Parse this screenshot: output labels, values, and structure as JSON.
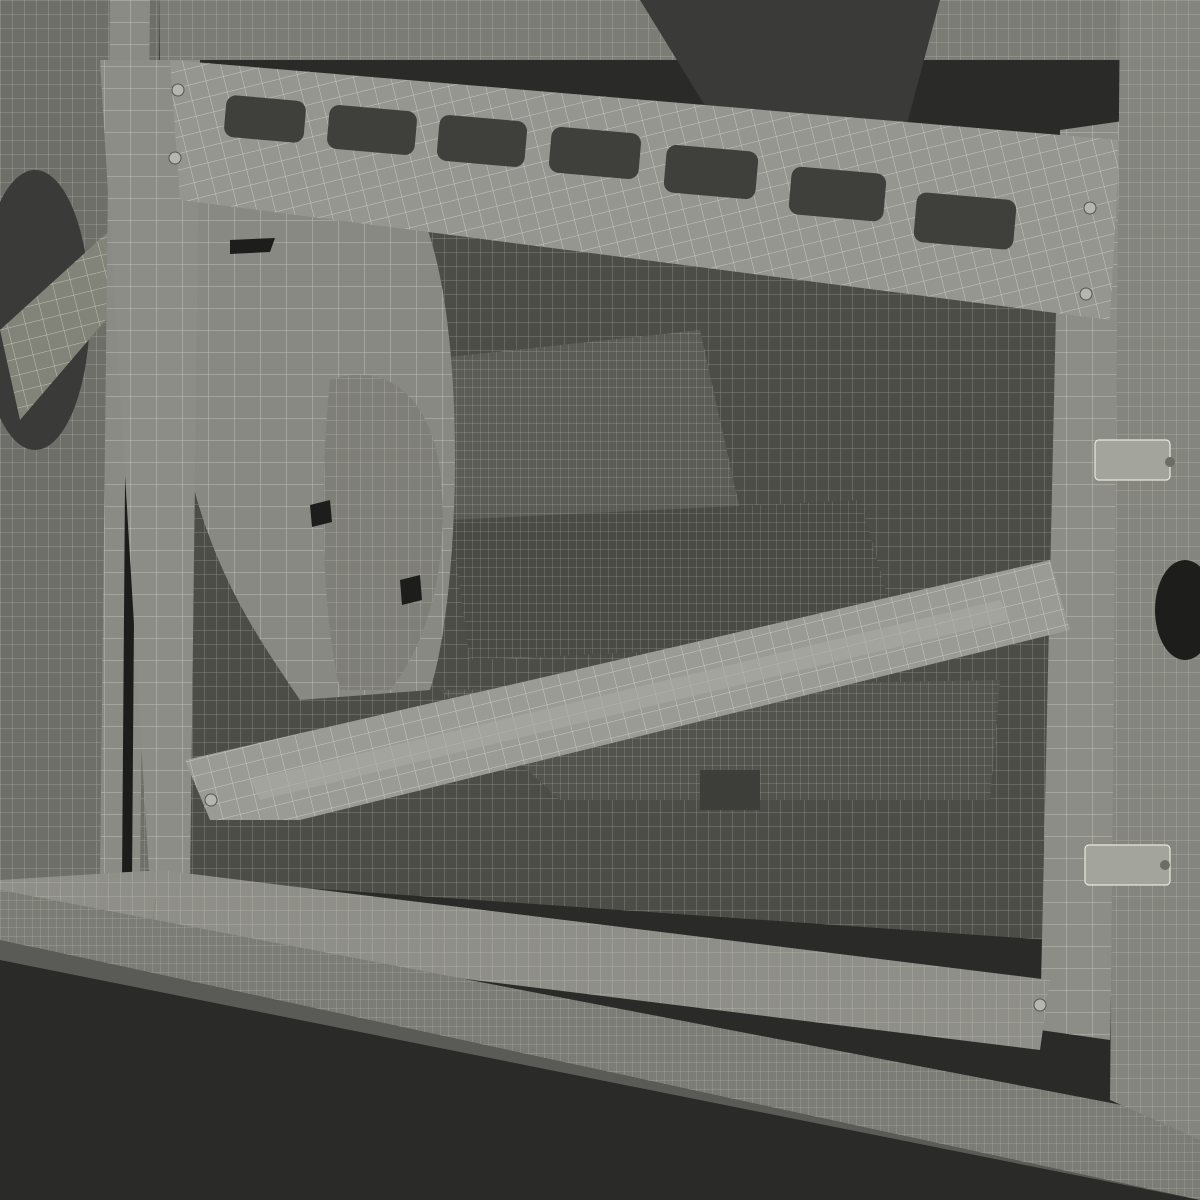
{
  "scene": {
    "subject": "car-door-frame-wireframe-render",
    "colors": {
      "background": "#2a2a29",
      "void": "#3a3a38",
      "panel": "#7f807a",
      "panel_light": "#9c9d96",
      "panel_dark": "#5f605b",
      "interior": "#55564f",
      "interior_dark": "#44453f",
      "wire": "#e9e8dc",
      "rail": "#5a5a56"
    }
  }
}
